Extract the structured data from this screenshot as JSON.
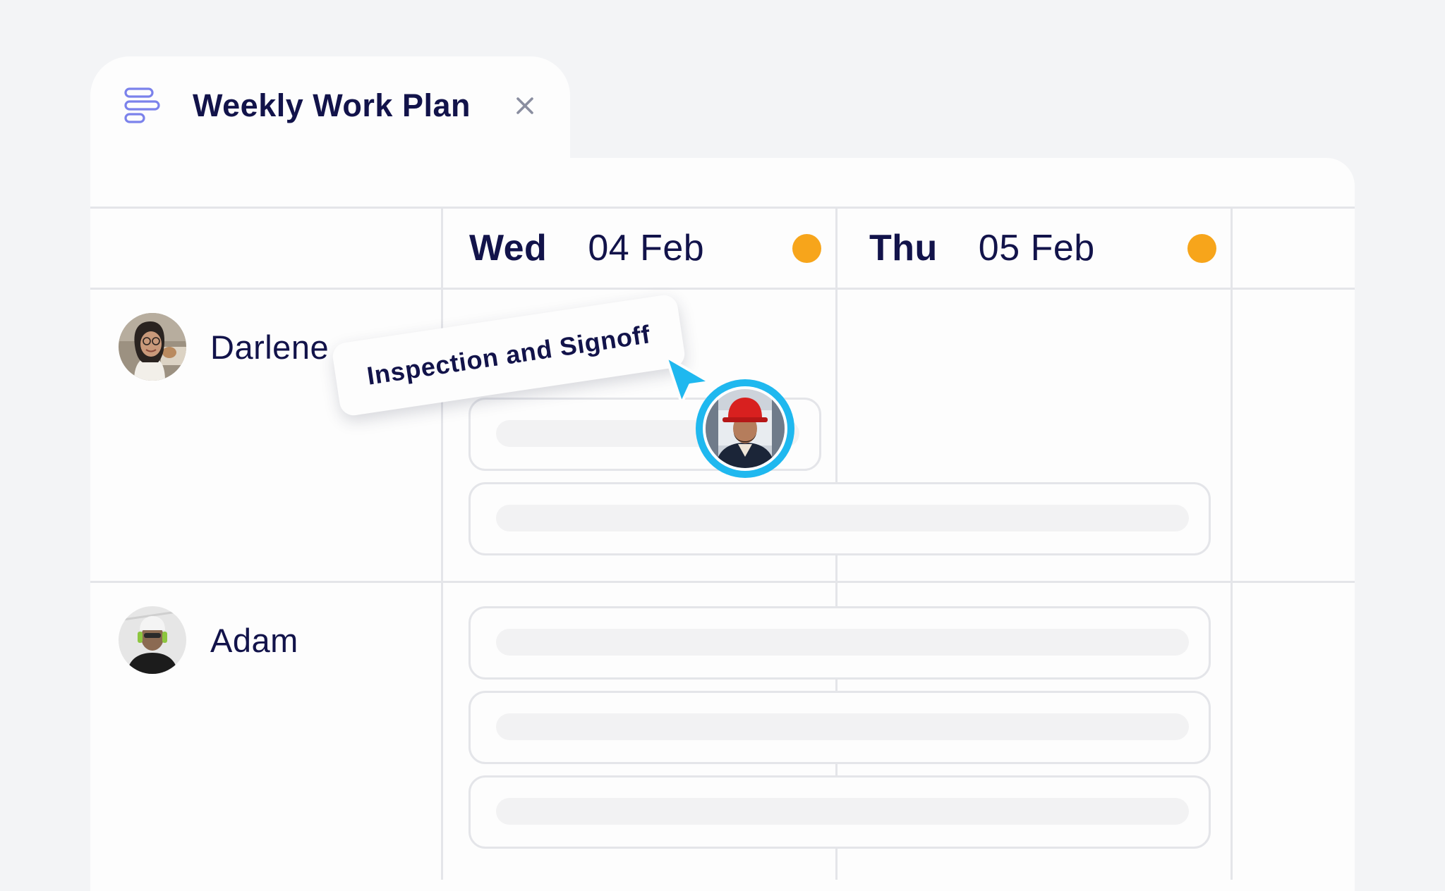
{
  "tab": {
    "icon": "gantt-icon",
    "title": "Weekly Work Plan",
    "close_icon": "close-icon"
  },
  "columns": [
    {
      "day": "Wed",
      "date": "04 Feb",
      "status_color": "#f7a51b"
    },
    {
      "day": "Thu",
      "date": "05 Feb",
      "status_color": "#f7a51b"
    }
  ],
  "rows": [
    {
      "name": "Darlene",
      "avatar": "avatar-darlene",
      "task_count": 2
    },
    {
      "name": "Adam",
      "avatar": "avatar-adam",
      "task_count": 3
    }
  ],
  "dragging": {
    "label": "Inspection and Signoff",
    "cursor_icon": "pointer-cursor-icon",
    "user_avatar": "avatar-hardhat-worker"
  },
  "colors": {
    "text": "#12134a",
    "status": "#f7a51b",
    "accent": "#1fb8ef",
    "tab_icon": "#7b82eb",
    "border": "#e4e5e9"
  }
}
